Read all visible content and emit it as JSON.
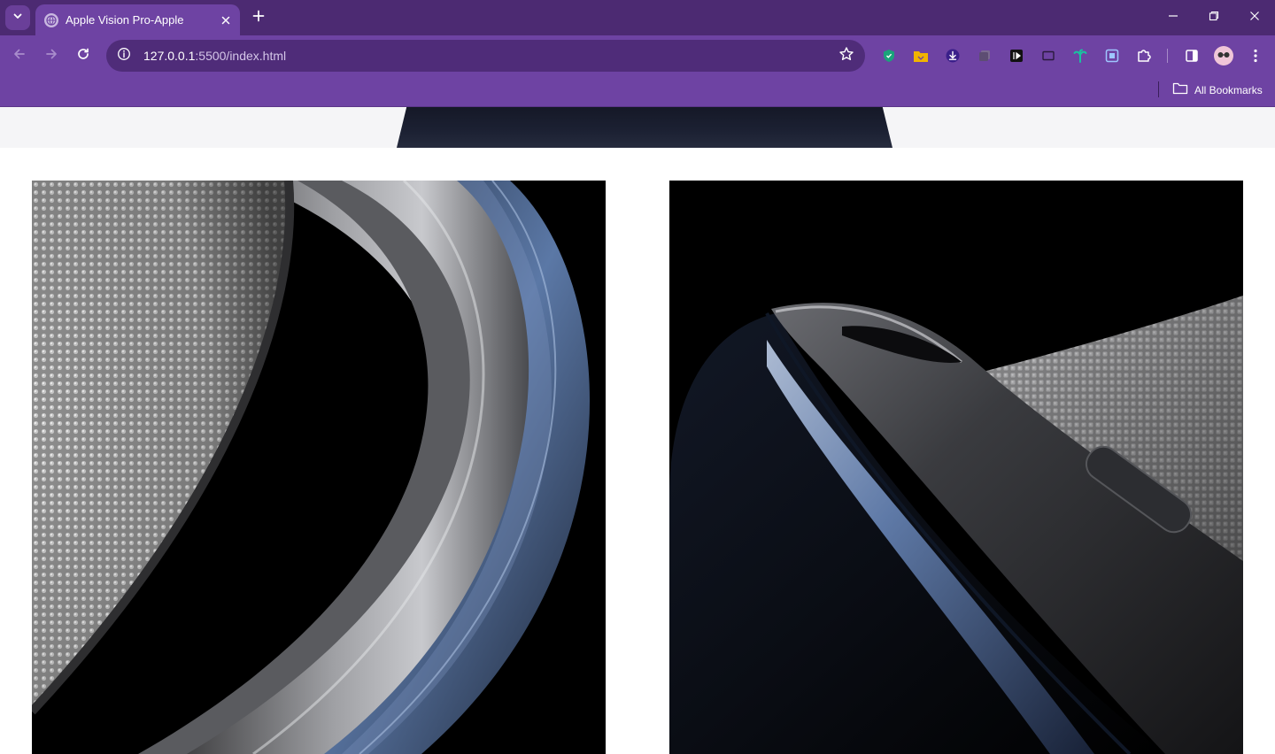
{
  "browser": {
    "tab_title": "Apple Vision Pro-Apple",
    "url_host": "127.0.0.1",
    "url_path": ":5500/index.html",
    "bookmarks_label": "All Bookmarks",
    "icons": {
      "tab_search": "chevron-down-icon",
      "favicon": "globe-icon",
      "close_tab": "close-icon",
      "new_tab": "plus-icon",
      "back": "arrow-left-icon",
      "forward": "arrow-right-icon",
      "reload": "reload-icon",
      "site_info": "info-icon",
      "bookmark_star": "star-icon",
      "extensions": [
        "shield-extension-icon",
        "folder-extension-icon",
        "download-extension-icon",
        "tabs-extension-icon",
        "media-extension-icon",
        "window-extension-icon",
        "palm-extension-icon",
        "crop-extension-icon",
        "puzzle-icon"
      ],
      "side_panel": "side-panel-icon",
      "profile": "avatar",
      "menu": "kebab-menu-icon",
      "bookmarks_folder": "folder-icon"
    },
    "colors": {
      "frame": "#4c2a72",
      "toolbar": "#6e43a3",
      "omnibox": "#4f2c79"
    }
  },
  "page": {
    "images": [
      {
        "name": "headband-closeup-left",
        "description_visible": ""
      },
      {
        "name": "headband-closeup-right",
        "description_visible": ""
      }
    ]
  }
}
